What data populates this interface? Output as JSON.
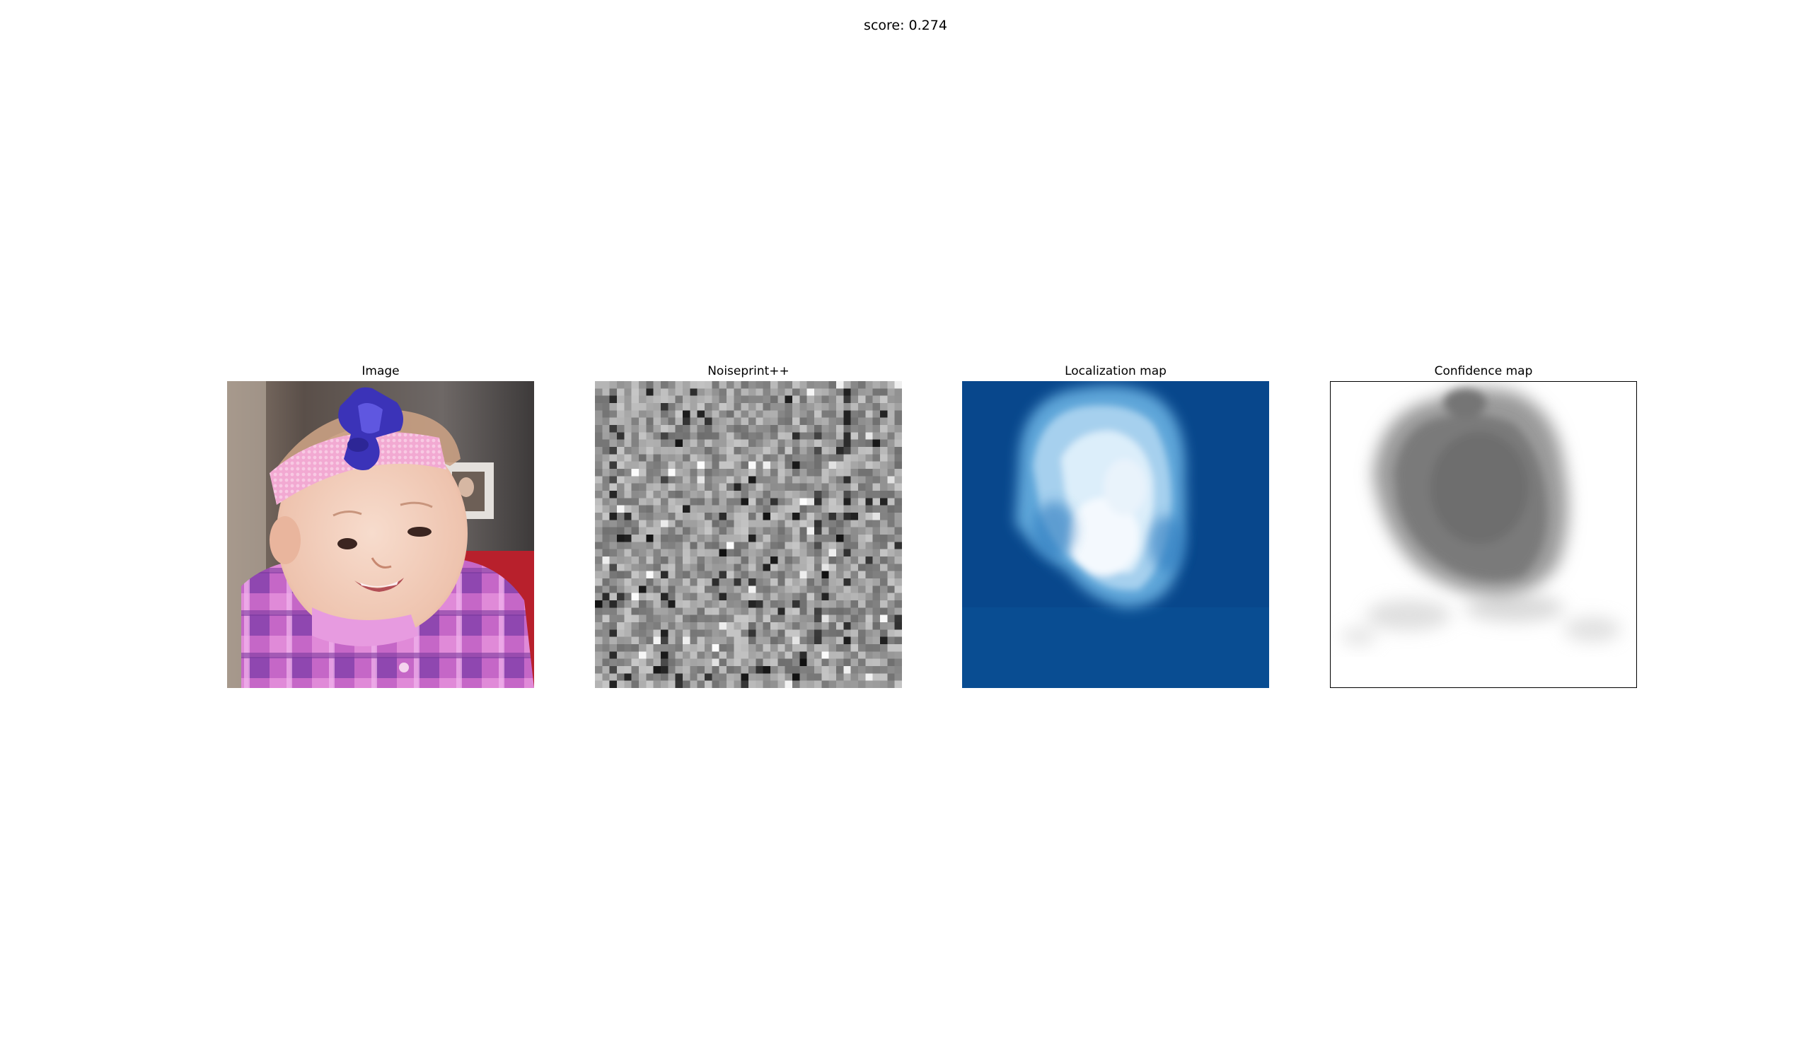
{
  "figure": {
    "suptitle": "score: 0.274"
  },
  "panels": [
    {
      "title": "Image",
      "content": "photo"
    },
    {
      "title": "Noiseprint++",
      "content": "grayscale-noise-grid",
      "colormap": "gray"
    },
    {
      "title": "Localization map",
      "content": "heatmap",
      "colormap": "blues",
      "background_color": "#08478c",
      "highlight_color": "#ffffff"
    },
    {
      "title": "Confidence map",
      "content": "heatmap",
      "colormap": "gray",
      "background_color": "#ffffff",
      "highlight_color": "#707070"
    }
  ]
}
